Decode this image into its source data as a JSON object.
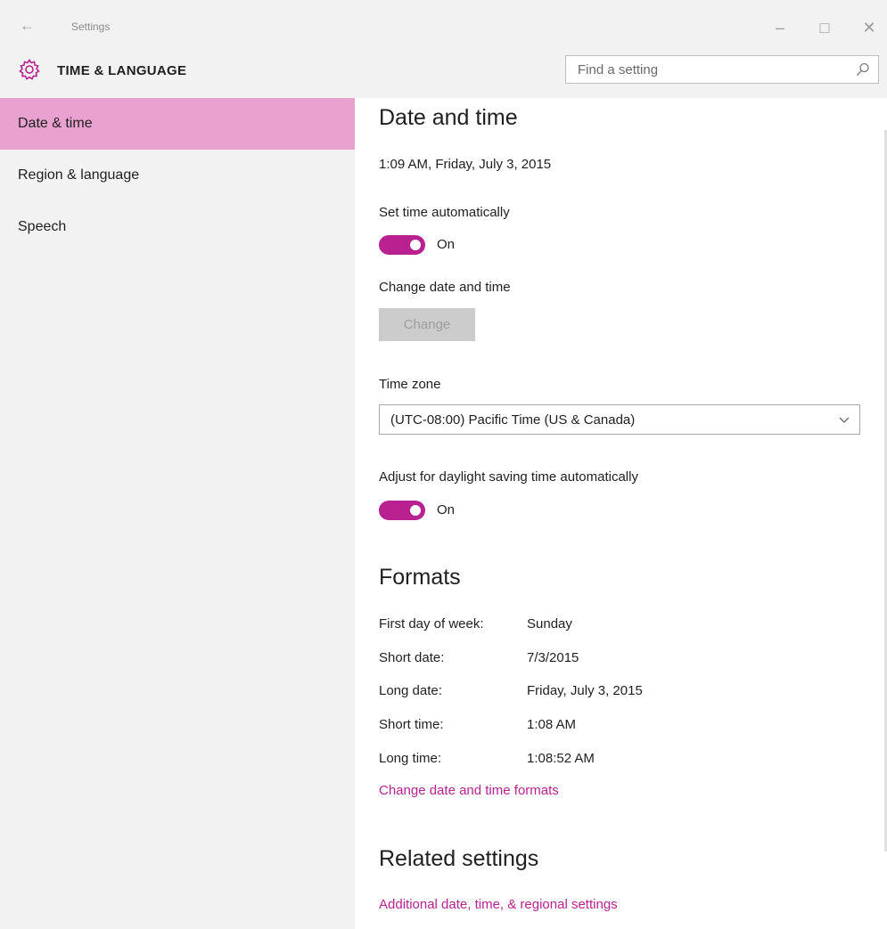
{
  "window": {
    "app_title": "Settings",
    "back_icon": "back-arrow-icon",
    "minimize_icon": "minimize-icon",
    "maximize_icon": "maximize-icon",
    "close_icon": "close-icon"
  },
  "header": {
    "section_title": "TIME & LANGUAGE",
    "section_icon": "gear-icon",
    "search": {
      "placeholder": "Find a setting",
      "icon": "search-icon"
    }
  },
  "sidebar": {
    "items": [
      {
        "label": "Date & time",
        "selected": true
      },
      {
        "label": "Region & language",
        "selected": false
      },
      {
        "label": "Speech",
        "selected": false
      }
    ]
  },
  "main": {
    "date_time": {
      "heading": "Date and time",
      "current": "1:09 AM, Friday, July 3, 2015",
      "set_auto_label": "Set time automatically",
      "set_auto_state": "On",
      "change_label": "Change date and time",
      "change_button": "Change",
      "timezone_label": "Time zone",
      "timezone_value": "(UTC-08:00) Pacific Time (US & Canada)",
      "dst_label": "Adjust for daylight saving time automatically",
      "dst_state": "On"
    },
    "formats": {
      "heading": "Formats",
      "rows": [
        {
          "label": "First day of week:",
          "value": "Sunday"
        },
        {
          "label": "Short date:",
          "value": "7/3/2015"
        },
        {
          "label": "Long date:",
          "value": "Friday, July 3, 2015"
        },
        {
          "label": "Short time:",
          "value": "1:08 AM"
        },
        {
          "label": "Long time:",
          "value": "1:08:52 AM"
        }
      ],
      "change_link": "Change date and time formats"
    },
    "related": {
      "heading": "Related settings",
      "link": "Additional date, time, & regional settings"
    }
  },
  "colors": {
    "accent": "#b8218f",
    "selected_nav": "#e9a1cf",
    "chrome_bg": "#f2f2f2"
  }
}
